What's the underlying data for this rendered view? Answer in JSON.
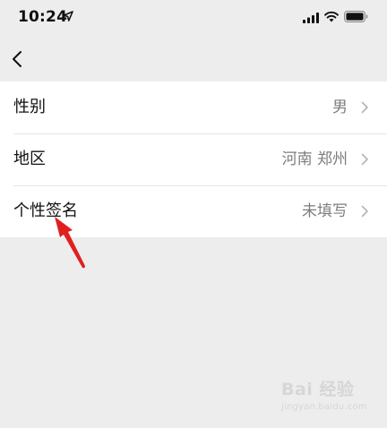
{
  "status_bar": {
    "time": "10:24",
    "icons": [
      "location-arrow-icon",
      "signal-icon",
      "wifi-icon",
      "battery-icon"
    ]
  },
  "nav": {
    "back_icon": "chevron-left-icon"
  },
  "settings": [
    {
      "label": "性别",
      "value": "男"
    },
    {
      "label": "地区",
      "value": "河南 郑州"
    },
    {
      "label": "个性签名",
      "value": "未填写"
    }
  ],
  "annotation": {
    "type": "red-arrow",
    "color": "#e02020"
  },
  "watermark": {
    "text": "Bai 经验",
    "url": "jingyan.baidu.com"
  },
  "colors": {
    "background": "#ededed",
    "row_background": "#ffffff",
    "value_text": "#7d7d7d",
    "chevron": "#b5b5b5"
  }
}
